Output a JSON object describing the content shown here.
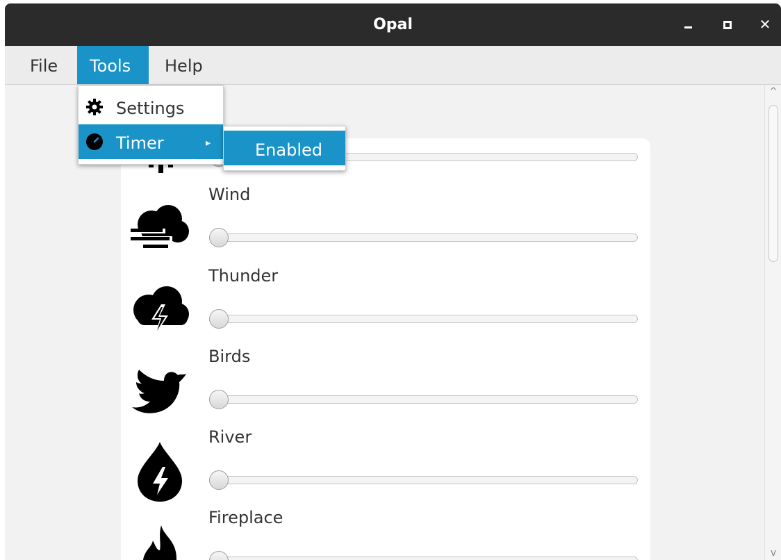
{
  "window": {
    "title": "Opal",
    "close_glyph": "✕"
  },
  "menubar": {
    "file": "File",
    "tools": "Tools",
    "help": "Help"
  },
  "tools_menu": {
    "settings": {
      "label": "Settings",
      "icon": "gear-icon"
    },
    "timer": {
      "label": "Timer",
      "icon": "clock-icon",
      "arrow": "▸"
    }
  },
  "timer_submenu": {
    "enabled": "Enabled"
  },
  "sounds": [
    {
      "label": "",
      "icon": "rain-cloud-icon",
      "volume": 0
    },
    {
      "label": "Wind",
      "icon": "wind-cloud-icon",
      "volume": 0
    },
    {
      "label": "Thunder",
      "icon": "thunder-cloud-icon",
      "volume": 0
    },
    {
      "label": "Birds",
      "icon": "bird-icon",
      "volume": 0
    },
    {
      "label": "River",
      "icon": "water-drop-bolt-icon",
      "volume": 0
    },
    {
      "label": "Fireplace",
      "icon": "fire-icon",
      "volume": 0
    }
  ],
  "scrollbar": {
    "up": "^",
    "down": "v"
  },
  "colors": {
    "accent": "#1a93c8",
    "titlebar": "#2b2b2b",
    "menubar": "#ececec"
  }
}
